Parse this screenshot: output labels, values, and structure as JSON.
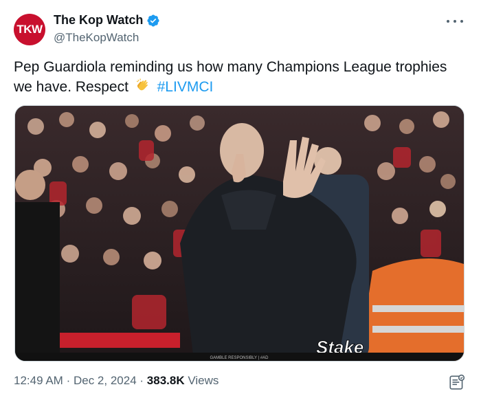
{
  "author": {
    "avatar_text": "TKW",
    "display_name": "The Kop Watch",
    "handle": "@TheKopWatch",
    "verified": true,
    "avatar_color": "#c8102e",
    "verified_color": "#1d9bf0"
  },
  "tweet": {
    "text": "Pep Guardiola reminding us how many Champions League trophies we have. Respect",
    "emoji": "clapping-hands",
    "hashtag": "#LIVMCI"
  },
  "media": {
    "type": "photo",
    "watermark": "Stake",
    "footer_text": "GAMBLE RESPONSIBLY | #AD"
  },
  "meta": {
    "time": "12:49 AM",
    "date": "Dec 2, 2024",
    "views_count": "383.8K",
    "views_label": "Views",
    "separator": "·"
  },
  "icons": {
    "more": "more-dots-icon",
    "verified": "verified-badge-icon",
    "notes": "community-notes-icon"
  }
}
